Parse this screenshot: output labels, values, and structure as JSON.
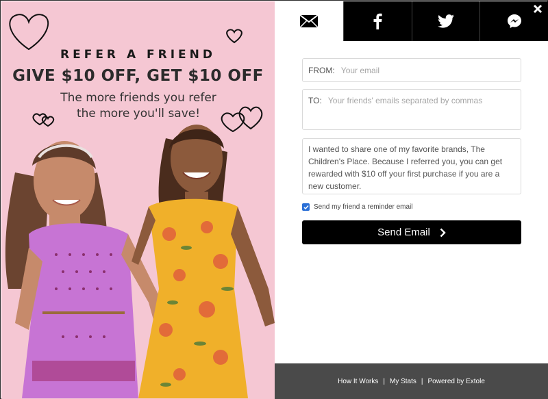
{
  "promo": {
    "eyebrow": "REFER A FRIEND",
    "headline": "GIVE $10 OFF, GET $10 OFF",
    "subline_1": "The more friends you refer",
    "subline_2": "the more you'll save!"
  },
  "tabs": [
    {
      "name": "email",
      "icon": "envelope-icon",
      "active": true
    },
    {
      "name": "facebook",
      "icon": "facebook-icon",
      "active": false
    },
    {
      "name": "twitter",
      "icon": "twitter-icon",
      "active": false
    },
    {
      "name": "messenger",
      "icon": "messenger-icon",
      "active": false
    }
  ],
  "form": {
    "from_label": "FROM:",
    "from_placeholder": "Your email",
    "to_label": "TO:",
    "to_placeholder": "Your friends' emails separated by commas",
    "message": "I wanted to share one of my favorite brands, The Children's Place. Because I referred you, you can get rewarded with $10 off your first purchase if you are a new customer.",
    "reminder_label": "Send my friend a reminder email",
    "reminder_checked": true,
    "send_label": "Send Email"
  },
  "footer": {
    "how_it_works": "How It Works",
    "my_stats": "My Stats",
    "powered_by": "Powered by Extole",
    "separator": "|"
  },
  "colors": {
    "promo_bg": "#f5c7d3",
    "button_bg": "#000000",
    "footer_bg": "#4a4a4a",
    "checkbox": "#2a6fd6"
  }
}
